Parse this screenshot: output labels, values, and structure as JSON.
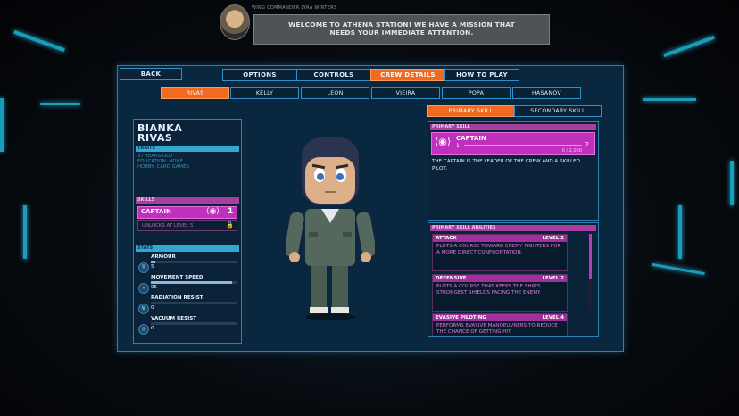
{
  "comm": {
    "speaker": "WING COMMANDER LYRA WINTERS",
    "message": "WELCOME TO ATHENA STATION! WE HAVE A MISSION THAT NEEDS YOUR IMMEDIATE ATTENTION."
  },
  "nav": {
    "back": "BACK",
    "tabs": [
      {
        "label": "OPTIONS",
        "active": false
      },
      {
        "label": "CONTROLS",
        "active": false
      },
      {
        "label": "CREW DETAILS",
        "active": true
      },
      {
        "label": "HOW TO PLAY",
        "active": false
      }
    ]
  },
  "crew_tabs": [
    {
      "label": "RIVAS",
      "active": true
    },
    {
      "label": "KELLY",
      "active": false
    },
    {
      "label": "LEON",
      "active": false
    },
    {
      "label": "VIEIRA",
      "active": false
    },
    {
      "label": "POPA",
      "active": false
    },
    {
      "label": "HASANOV",
      "active": false
    }
  ],
  "character": {
    "first_name": "BIANKA",
    "last_name": "RIVAS",
    "traits_header": "TRAITS",
    "traits": [
      "37 YEARS OLD",
      "EDUCATION: NONE",
      "HOBBY: CARD GAMES"
    ],
    "skills_header": "SKILLS",
    "skill_name": "CAPTAIN",
    "skill_level": "1",
    "unlock_text": "UNLOCKS AT LEVEL 5",
    "stats_header": "STATS",
    "stats": [
      {
        "label": "ARMOUR",
        "value": "5",
        "fill": 0.05
      },
      {
        "label": "MOVEMENT SPEED",
        "value": "95",
        "fill": 0.95
      },
      {
        "label": "RADIATION RESIST",
        "value": "0",
        "fill": 0.0
      },
      {
        "label": "VACUUM RESIST",
        "value": "0",
        "fill": 0.0
      }
    ]
  },
  "skill_tabs": [
    {
      "label": "PRIMARY SKILL",
      "active": true
    },
    {
      "label": "SECONDARY SKILL",
      "active": false
    }
  ],
  "primary": {
    "header": "PRIMARY SKILL",
    "name": "CAPTAIN",
    "level_from": "1",
    "level_to": "2",
    "xp": "0 / 2,000",
    "xp_fraction": 0.0,
    "description": "THE CAPTAIN IS THE LEADER OF THE CREW AND A SKILLED PILOT.",
    "abilities_header": "PRIMARY SKILL ABILITIES",
    "abilities": [
      {
        "name": "ATTACK",
        "level": "LEVEL 2",
        "text": "PLOTS A COURSE TOWARD ENEMY FIGHTERS FOR A MORE DIRECT CONFRONTATION."
      },
      {
        "name": "DEFENSIVE",
        "level": "LEVEL 2",
        "text": "PLOTS A COURSE THAT KEEPS THE SHIP'S STRONGEST SHIELDS FACING THE ENEMY."
      },
      {
        "name": "EVASIVE PILOTING",
        "level": "LEVEL 4",
        "text": "PERFORMS EVASIVE MANOEUVRERS TO REDUCE THE CHANCE OF GETTING HIT."
      }
    ]
  },
  "colors": {
    "accent": "#f26a21",
    "panel": "#0a2740",
    "skill": "#c12fbd",
    "border": "#2e90c8"
  }
}
